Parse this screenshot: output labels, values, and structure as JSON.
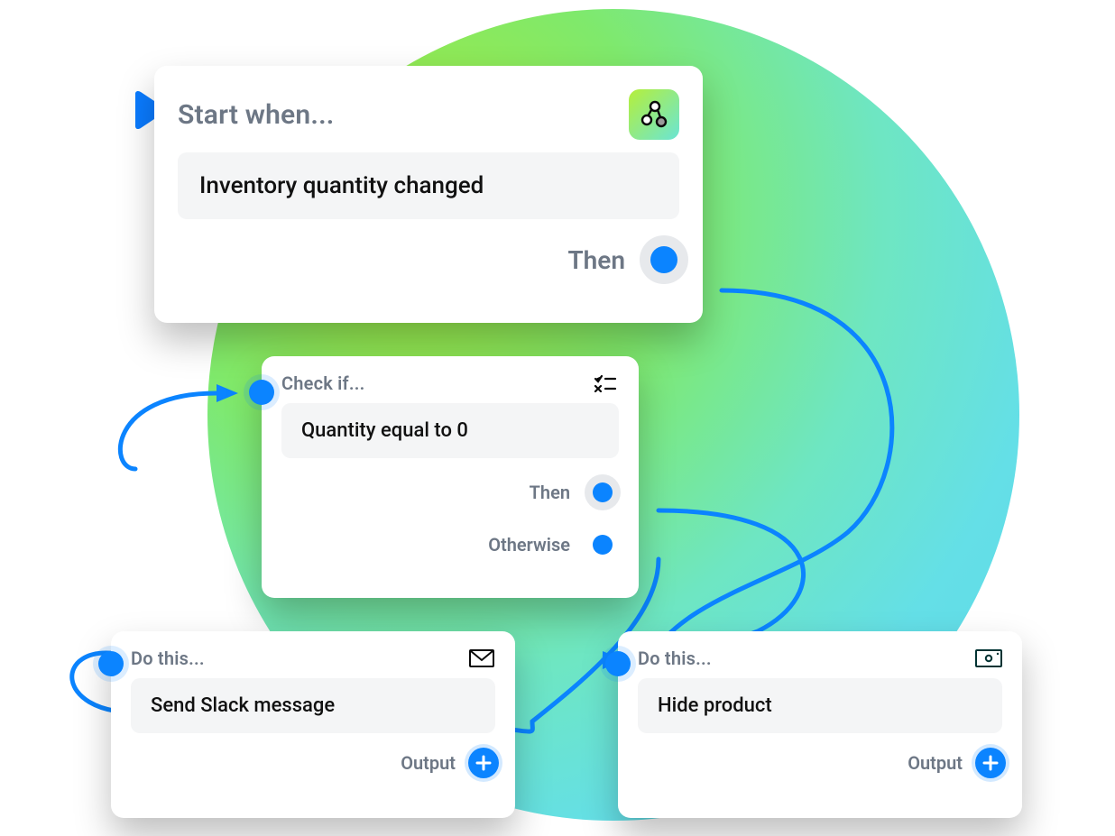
{
  "trigger": {
    "heading": "Start when...",
    "value": "Inventory quantity changed",
    "out_label": "Then",
    "icon": "flow-icon"
  },
  "condition": {
    "heading": "Check if...",
    "value": "Quantity equal to 0",
    "then_label": "Then",
    "otherwise_label": "Otherwise",
    "icon": "checklist-icon"
  },
  "action_left": {
    "heading": "Do this...",
    "value": "Send Slack message",
    "out_label": "Output",
    "icon": "mail-icon"
  },
  "action_right": {
    "heading": "Do this...",
    "value": "Hide product",
    "out_label": "Output",
    "icon": "cash-icon"
  },
  "colors": {
    "accent": "#0b84ff",
    "text_muted": "#6d7785",
    "chip_bg": "#f4f5f6"
  }
}
